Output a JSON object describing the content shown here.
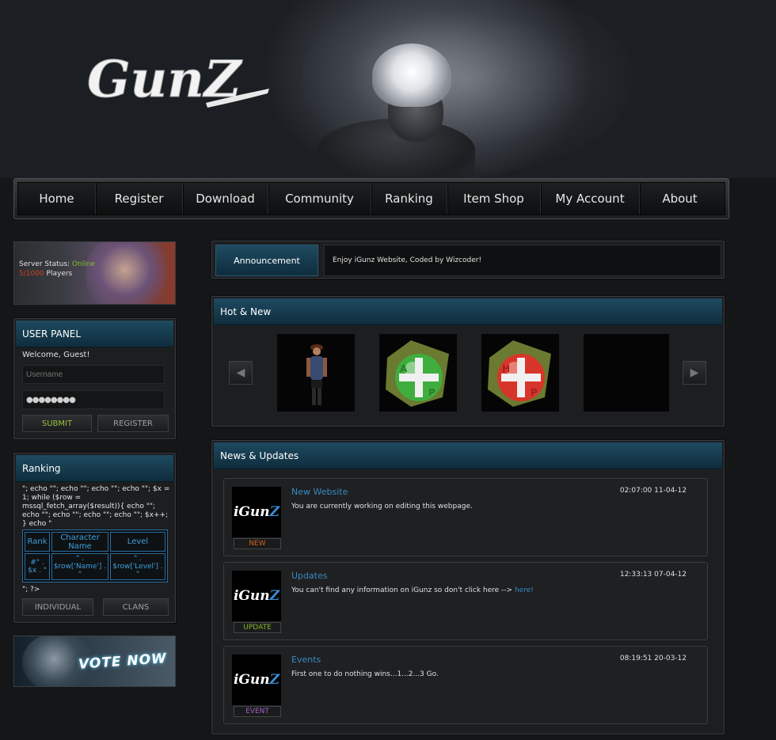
{
  "header": {
    "logo_text": "GunZ"
  },
  "nav": {
    "items": [
      "Home",
      "Register",
      "Download",
      "Community",
      "Ranking",
      "Item Shop",
      "My Account",
      "About"
    ]
  },
  "server": {
    "label": "Server Status:",
    "status": "Online",
    "players_count": "5/1000",
    "players_label": "Players",
    "status_color": "#7fbf2a",
    "count_color": "#d04020"
  },
  "user_panel": {
    "title": "USER PANEL",
    "welcome": "Welcome, Guest!",
    "username_placeholder": "Username",
    "password_value": "●●●●●●●●",
    "submit": "SUBMIT",
    "register": "REGISTER"
  },
  "ranking": {
    "title": "Ranking",
    "code_text": "\"; echo \"\"; echo \"\"; echo \"\"; echo \"\"; $x = 1; while ($row = mssql_fetch_array($result)){ echo \"\"; echo \"\"; echo \"\"; echo \"\"; echo \"\"; $x++; } echo \"",
    "headers": [
      "Rank",
      "Character Name",
      "Level"
    ],
    "row": [
      "#\" . $x . \"",
      "\" . $row['Name'] . \"",
      "\" . $row['Level'] . \""
    ],
    "tail": "\"; ?>",
    "individual": "INDIVIDUAL",
    "clans": "CLANS"
  },
  "vote": {
    "label": "VOTE NOW"
  },
  "announcement": {
    "label": "Announcement",
    "text": "Enjoy iGunz Website, Coded by Wizcoder!"
  },
  "hot_new": {
    "title": "Hot & New"
  },
  "news": {
    "title": "News & Updates",
    "logo_main": "iGun",
    "logo_accent": "Z",
    "items": [
      {
        "title": "New Website",
        "time": "02:07:00 11-04-12",
        "body": "You are currently working on editing this webpage.",
        "tag": "NEW",
        "tag_color": "#d0601a"
      },
      {
        "title": "Updates",
        "time": "12:33:13 07-04-12",
        "body": "You can't find any information on iGunz so don't click here -->",
        "link": "here!",
        "tag": "UPDATE",
        "tag_color": "#8ab52a"
      },
      {
        "title": "Events",
        "time": "08:19:51 20-03-12",
        "body": "First one to do nothing wins...1...2...3 Go.",
        "tag": "EVENT",
        "tag_color": "#a060c0"
      }
    ]
  }
}
